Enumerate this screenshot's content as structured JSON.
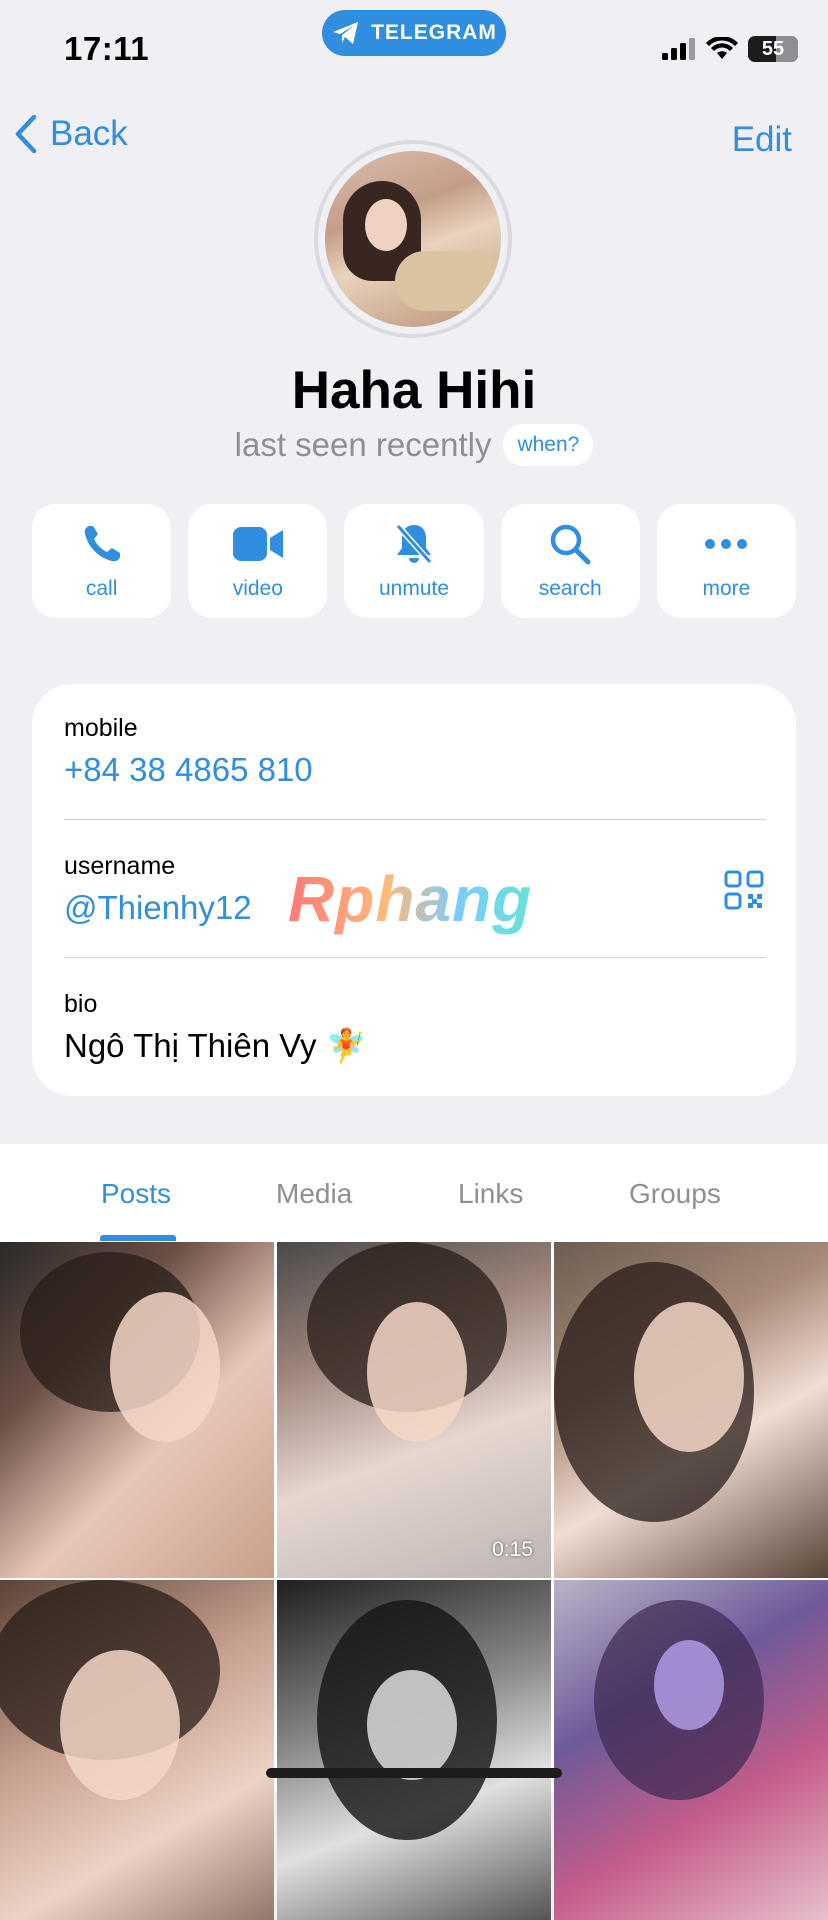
{
  "status_bar": {
    "time": "17:11",
    "app_pill": "TELEGRAM",
    "battery": "55"
  },
  "nav": {
    "back_label": "Back",
    "edit_label": "Edit"
  },
  "profile": {
    "name": "Haha Hihi",
    "status": "last seen recently",
    "when_label": "when?"
  },
  "actions": [
    {
      "label": "call",
      "icon": "phone-icon"
    },
    {
      "label": "video",
      "icon": "video-camera-icon"
    },
    {
      "label": "unmute",
      "icon": "bell-slash-icon"
    },
    {
      "label": "search",
      "icon": "search-icon"
    },
    {
      "label": "more",
      "icon": "ellipsis-icon"
    }
  ],
  "info": {
    "mobile_key": "mobile",
    "mobile_value": "+84 38 4865 810",
    "username_key": "username",
    "username_value": "@Thienhy12",
    "bio_key": "bio",
    "bio_value": "Ngô Thị Thiên Vy 🧚"
  },
  "watermark": "Rphang",
  "tabs": [
    "Posts",
    "Media",
    "Links",
    "Groups"
  ],
  "active_tab": "Posts",
  "media": [
    {
      "duration": ""
    },
    {
      "duration": "0:15"
    },
    {
      "duration": ""
    },
    {
      "duration": ""
    },
    {
      "duration": ""
    },
    {
      "duration": ""
    }
  ],
  "colors": {
    "accent": "#2f8ee0",
    "background": "#efeff4",
    "secondary_text": "#8e8e93"
  }
}
